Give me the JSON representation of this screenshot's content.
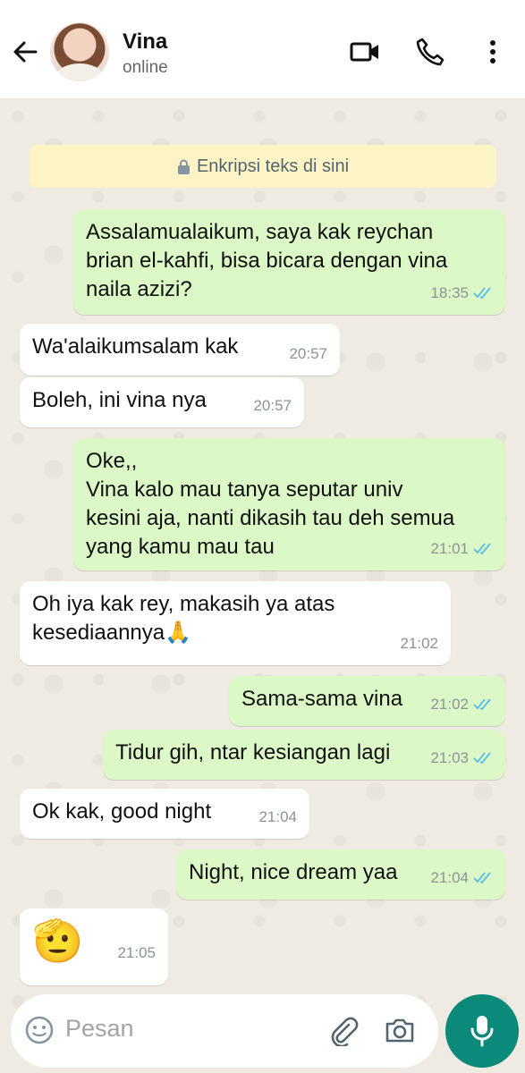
{
  "header": {
    "name": "Vina",
    "status": "online"
  },
  "encryption_notice": "Enkripsi teks di sini",
  "messages": [
    {
      "text": "Assalamualaikum, saya kak reychan\nbrian el-kahfi, bisa bicara dengan vina\nnaila azizi?",
      "time": "18:35",
      "direction": "out"
    },
    {
      "text": "Wa'alaikumsalam kak",
      "time": "20:57",
      "direction": "in"
    },
    {
      "text": "Boleh, ini vina nya",
      "time": "20:57",
      "direction": "in"
    },
    {
      "text": "Oke,,\nVina kalo mau tanya seputar univ\nkesini aja, nanti dikasih tau deh semua\nyang kamu mau tau",
      "time": "21:01",
      "direction": "out"
    },
    {
      "text": "Oh iya kak rey, makasih ya atas\nkesediaannya🙏",
      "time": "21:02",
      "direction": "in"
    },
    {
      "text": "Sama-sama vina",
      "time": "21:02",
      "direction": "out"
    },
    {
      "text": "Tidur gih, ntar kesiangan lagi",
      "time": "21:03",
      "direction": "out"
    },
    {
      "text": "Ok kak, good night",
      "time": "21:04",
      "direction": "in"
    },
    {
      "text": "Night, nice dream yaa",
      "time": "21:04",
      "direction": "out"
    },
    {
      "text": "🫡",
      "time": "21:05",
      "direction": "in"
    }
  ],
  "composer": {
    "placeholder": "Pesan"
  },
  "icons": [
    "back-arrow-icon",
    "video-call-icon",
    "phone-icon",
    "menu-dots-icon",
    "lock-icon",
    "emoji-icon",
    "attach-icon",
    "camera-icon",
    "mic-icon",
    "read-ticks-icon"
  ],
  "colors": {
    "outgoing": "#dcf8c6",
    "incoming": "#ffffff",
    "tick": "#53bdeb",
    "mic_button": "#0b8a79"
  }
}
